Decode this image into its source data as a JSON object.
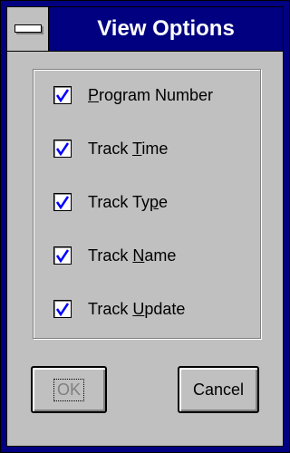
{
  "window": {
    "title": "View Options"
  },
  "options": [
    {
      "pre": "",
      "key": "P",
      "post": "rogram Number",
      "checked": true
    },
    {
      "pre": "Track ",
      "key": "T",
      "post": "ime",
      "checked": true
    },
    {
      "pre": "Track Ty",
      "key": "p",
      "post": "e",
      "checked": true
    },
    {
      "pre": "Track ",
      "key": "N",
      "post": "ame",
      "checked": true
    },
    {
      "pre": "Track ",
      "key": "U",
      "post": "pdate",
      "checked": true
    }
  ],
  "buttons": {
    "ok_label": "OK",
    "cancel_label": "Cancel"
  },
  "colors": {
    "titlebar": "#000080",
    "face": "#c0c0c0",
    "checkmark": "#0000ff"
  }
}
